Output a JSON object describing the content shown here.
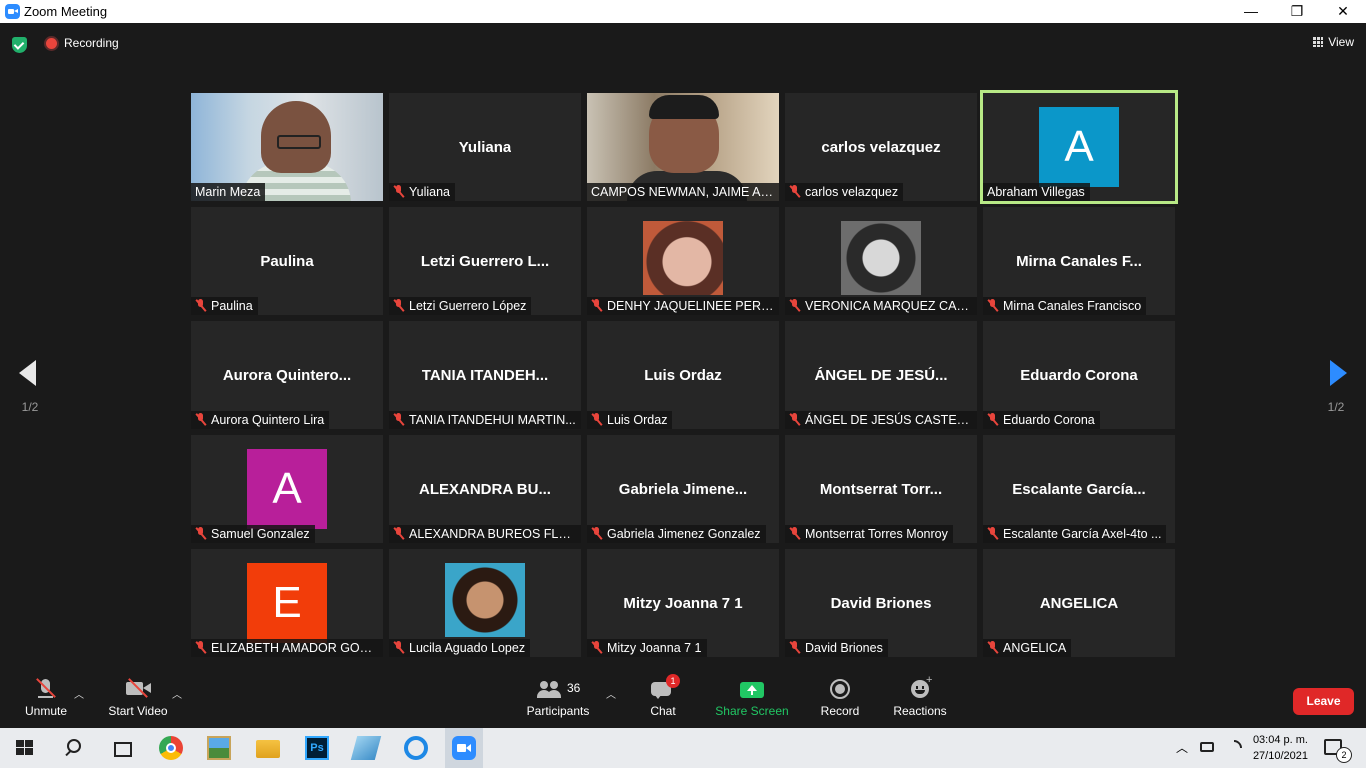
{
  "window": {
    "title": "Zoom Meeting",
    "minimize": "—",
    "maximize": "❐",
    "close": "✕"
  },
  "topbar": {
    "recording_label": "Recording",
    "view_label": "View"
  },
  "pagination": {
    "left": "1/2",
    "right": "1/2"
  },
  "tiles": [
    {
      "name": "Marin Meza",
      "label": "Marin Meza",
      "type": "video1",
      "muted": false
    },
    {
      "name": "Yuliana",
      "label": "Yuliana",
      "type": "name",
      "muted": true
    },
    {
      "name": "CAMPOS NEWMAN, JAIME AL...",
      "label": "CAMPOS NEWMAN, JAIME AL...",
      "type": "video2",
      "muted": false
    },
    {
      "name": "carlos velazquez",
      "label": "carlos velazquez",
      "type": "name",
      "muted": true
    },
    {
      "name": "Abraham Villegas",
      "label": "Abraham Villegas",
      "type": "avatar",
      "letter": "A",
      "color": "#0b97c9",
      "muted": false,
      "active": true
    },
    {
      "name": "Paulina",
      "label": "Paulina",
      "type": "name",
      "muted": true
    },
    {
      "name": "Letzi Guerrero L...",
      "label": "Letzi Guerrero López",
      "type": "name",
      "muted": true
    },
    {
      "name": "DENHY JAQUELINEE PEREZ...",
      "label": "DENHY JAQUELINEE PEREZ...",
      "type": "photo",
      "photo": "t1",
      "muted": true
    },
    {
      "name": "VERONICA MARQUEZ CAR...",
      "label": "VERONICA MARQUEZ CAR...",
      "type": "photo",
      "photo": "t2",
      "muted": true
    },
    {
      "name": "Mirna Canales F...",
      "label": "Mirna Canales Francisco",
      "type": "name",
      "muted": true
    },
    {
      "name": "Aurora Quintero...",
      "label": "Aurora Quintero Lira",
      "type": "name",
      "muted": true
    },
    {
      "name": "TANIA ITANDEH...",
      "label": "TANIA ITANDEHUI MARTIN...",
      "type": "name",
      "muted": true
    },
    {
      "name": "Luis Ordaz",
      "label": "Luis Ordaz",
      "type": "name",
      "muted": true
    },
    {
      "name": "ÁNGEL DE JESÚ...",
      "label": "ÁNGEL DE JESÚS CASTELÁ...",
      "type": "name",
      "muted": true
    },
    {
      "name": "Eduardo Corona",
      "label": "Eduardo Corona",
      "type": "name",
      "muted": true
    },
    {
      "name": "Samuel Gonzalez",
      "label": "Samuel Gonzalez",
      "type": "avatar",
      "letter": "A",
      "color": "#b81f9a",
      "muted": true
    },
    {
      "name": "ALEXANDRA BU...",
      "label": "ALEXANDRA BUREOS FLOR...",
      "type": "name",
      "muted": true
    },
    {
      "name": "Gabriela Jimene...",
      "label": "Gabriela Jimenez Gonzalez",
      "type": "name",
      "muted": true
    },
    {
      "name": "Montserrat Torr...",
      "label": "Montserrat Torres Monroy",
      "type": "name",
      "muted": true
    },
    {
      "name": "Escalante García...",
      "label": "Escalante García Axel-4to ...",
      "type": "name",
      "muted": true
    },
    {
      "name": "ELIZABETH AMADOR GON...",
      "label": "ELIZABETH AMADOR GON...",
      "type": "avatar",
      "letter": "E",
      "color": "#f23d0a",
      "muted": true
    },
    {
      "name": "Lucila Aguado Lopez",
      "label": "Lucila Aguado Lopez",
      "type": "photo",
      "photo": "t3",
      "muted": true
    },
    {
      "name": "Mitzy Joanna 7 1",
      "label": "Mitzy Joanna 7 1",
      "type": "name",
      "muted": true
    },
    {
      "name": "David Briones",
      "label": "David Briones",
      "type": "name",
      "muted": true
    },
    {
      "name": "ANGELICA",
      "label": "ANGELICA",
      "type": "name",
      "muted": true
    }
  ],
  "toolbar": {
    "unmute": "Unmute",
    "start_video": "Start Video",
    "participants": "Participants",
    "participants_count": "36",
    "chat": "Chat",
    "chat_badge": "1",
    "share_screen": "Share Screen",
    "record": "Record",
    "reactions": "Reactions",
    "leave": "Leave"
  },
  "taskbar": {
    "time": "03:04 p. m.",
    "date": "27/10/2021",
    "notif_count": "2"
  },
  "colors": {
    "share_green": "#21c764",
    "leave_red": "#e02828",
    "active_outline": "#b8e986",
    "accent_blue": "#2d8cff"
  }
}
